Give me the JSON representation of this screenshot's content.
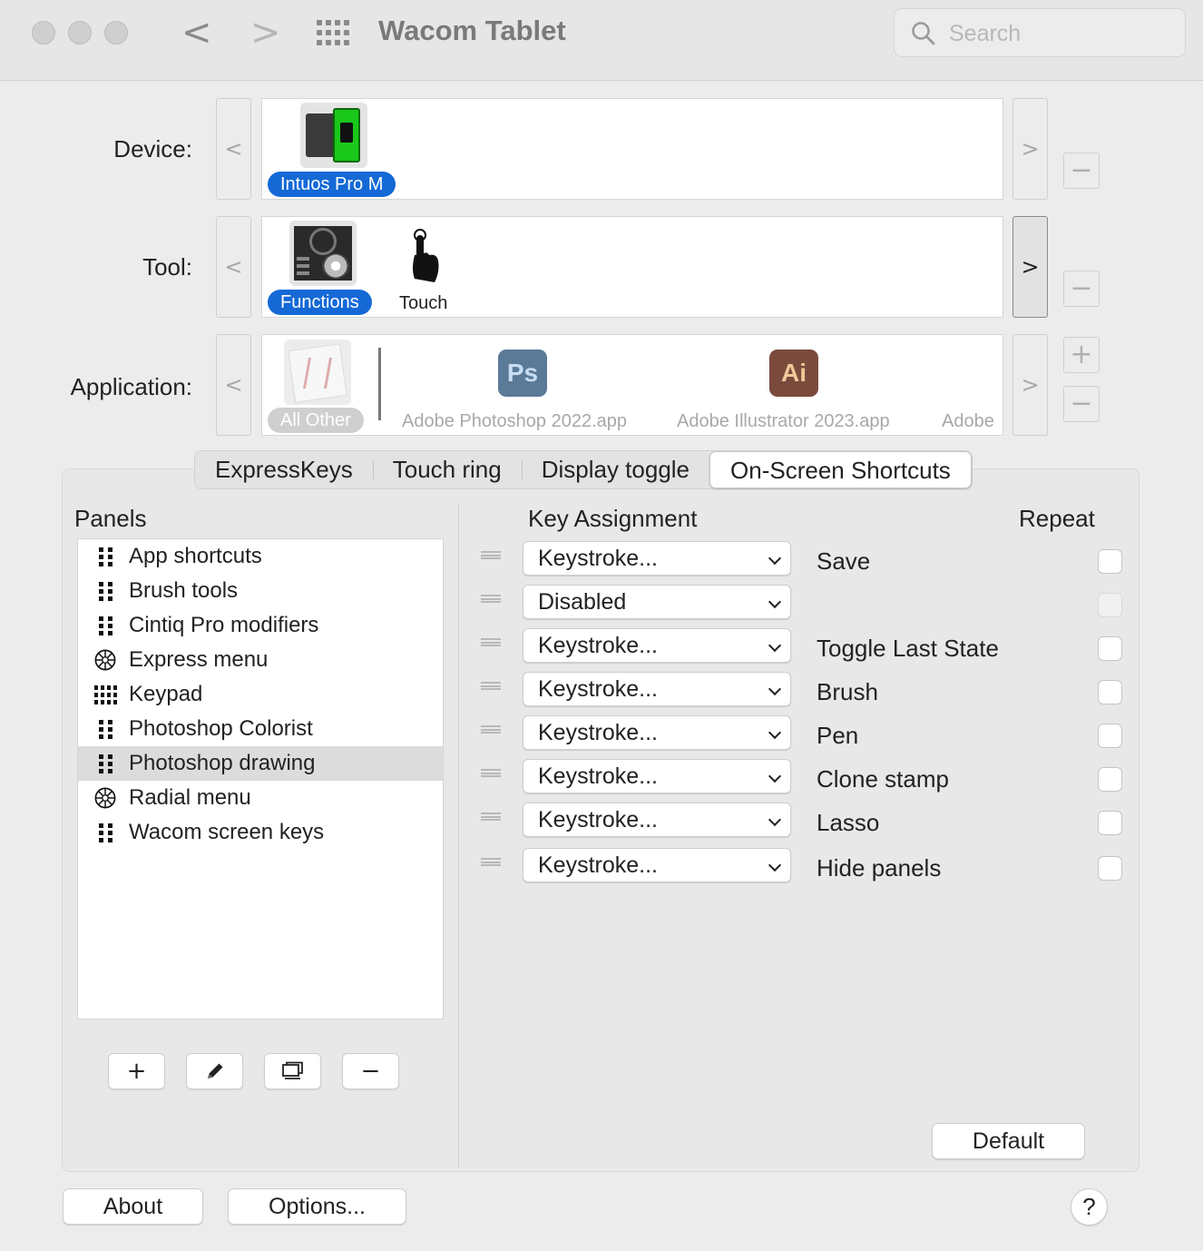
{
  "window": {
    "title": "Wacom Tablet",
    "search_placeholder": "Search",
    "back_glyph": "<",
    "forward_glyph": ">"
  },
  "device": {
    "label": "Device:",
    "items": [
      {
        "name": "Intuos Pro M",
        "icon": "tablet-battery-icon",
        "selected": true
      }
    ],
    "prev": "<",
    "next": ">",
    "remove": "−"
  },
  "tool": {
    "label": "Tool:",
    "items": [
      {
        "name": "Functions",
        "icon": "functions-icon",
        "selected": true
      },
      {
        "name": "Touch",
        "icon": "touch-hand-icon",
        "selected": false
      }
    ],
    "prev": "<",
    "next": ">",
    "remove": "−"
  },
  "application": {
    "label": "Application:",
    "items": [
      {
        "name": "All Other",
        "icon": "all-other-app-icon",
        "selected": true
      },
      {
        "name": "Adobe Photoshop 2022.app",
        "icon_text": "Ps",
        "color": "#5b7a98"
      },
      {
        "name": "Adobe Illustrator 2023.app",
        "icon_text": "Ai",
        "color": "#7a4a3c"
      },
      {
        "name": "Adobe"
      }
    ],
    "prev": "<",
    "next": ">",
    "add": "+",
    "remove": "−"
  },
  "tabs": [
    {
      "label": "ExpressKeys",
      "selected": false
    },
    {
      "label": "Touch ring",
      "selected": false
    },
    {
      "label": "Display toggle",
      "selected": false
    },
    {
      "label": "On-Screen Shortcuts",
      "selected": true
    }
  ],
  "panels": {
    "title": "Panels",
    "items": [
      {
        "label": "App shortcuts",
        "icon": "grid-2col-icon"
      },
      {
        "label": "Brush tools",
        "icon": "grid-2col-icon"
      },
      {
        "label": "Cintiq Pro modifiers",
        "icon": "grid-2col-icon"
      },
      {
        "label": "Express menu",
        "icon": "radial-wheel-icon"
      },
      {
        "label": "Keypad",
        "icon": "grid-4col-icon"
      },
      {
        "label": "Photoshop Colorist",
        "icon": "grid-2col-icon"
      },
      {
        "label": "Photoshop drawing",
        "icon": "grid-2col-icon",
        "selected": true
      },
      {
        "label": "Radial menu",
        "icon": "radial-wheel-icon"
      },
      {
        "label": "Wacom screen keys",
        "icon": "grid-2col-icon"
      }
    ],
    "buttons": {
      "add": "+",
      "remove": "−"
    }
  },
  "assignments": {
    "header_key": "Key Assignment",
    "header_repeat": "Repeat",
    "rows": [
      {
        "action": "Keystroke...",
        "label": "Save",
        "repeat_enabled": true
      },
      {
        "action": "Disabled",
        "label": "",
        "repeat_enabled": false
      },
      {
        "action": "Keystroke...",
        "label": "Toggle Last State",
        "repeat_enabled": true
      },
      {
        "action": "Keystroke...",
        "label": "Brush",
        "repeat_enabled": true
      },
      {
        "action": "Keystroke...",
        "label": "Pen",
        "repeat_enabled": true
      },
      {
        "action": "Keystroke...",
        "label": "Clone stamp",
        "repeat_enabled": true
      },
      {
        "action": "Keystroke...",
        "label": "Lasso",
        "repeat_enabled": true
      },
      {
        "action": "Keystroke...",
        "label": "Hide panels",
        "repeat_enabled": true
      }
    ],
    "default_button": "Default"
  },
  "footer": {
    "about": "About",
    "options": "Options...",
    "help": "?"
  },
  "colors": {
    "accent": "#1469d6",
    "window_bg": "#ececec"
  }
}
